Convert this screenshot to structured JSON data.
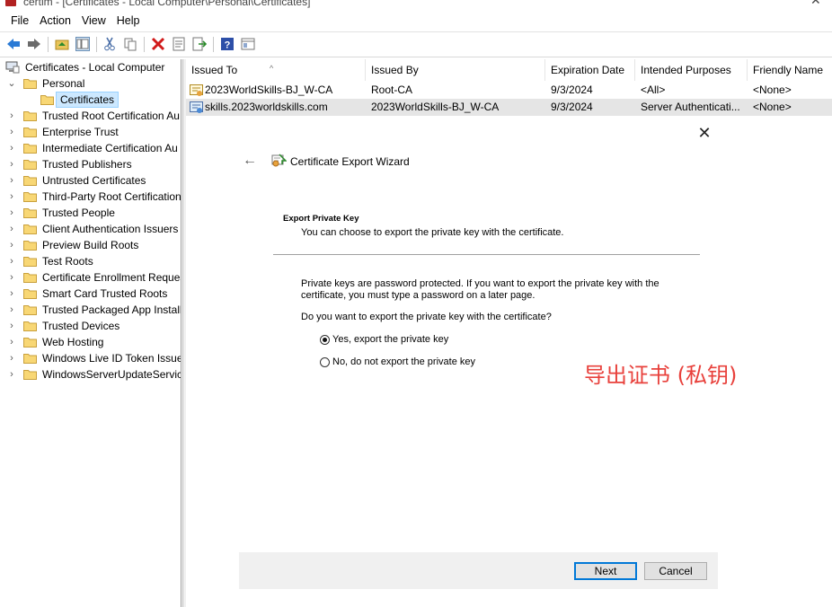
{
  "window": {
    "title": "certlm - [Certificates - Local Computer\\Personal\\Certificates]"
  },
  "menu": [
    "File",
    "Action",
    "View",
    "Help"
  ],
  "toolbar": {
    "icons": [
      "back-icon",
      "forward-icon",
      "up-folder-icon",
      "show-hide-tree-icon",
      "cut-icon",
      "copy-icon",
      "delete-icon",
      "properties-icon",
      "export-list-icon",
      "help-icon",
      "view-icon"
    ]
  },
  "tree": {
    "root": "Certificates - Local Computer",
    "personal": "Personal",
    "selected": "Certificates",
    "stores": [
      "Trusted Root Certification Au",
      "Enterprise Trust",
      "Intermediate Certification Au",
      "Trusted Publishers",
      "Untrusted Certificates",
      "Third-Party Root Certification",
      "Trusted People",
      "Client Authentication Issuers",
      "Preview Build Roots",
      "Test Roots",
      "Certificate Enrollment Reques",
      "Smart Card Trusted Roots",
      "Trusted Packaged App Installa",
      "Trusted Devices",
      "Web Hosting",
      "Windows Live ID Token Issuer",
      "WindowsServerUpdateService"
    ]
  },
  "list": {
    "columns": [
      "Issued To",
      "Issued By",
      "Expiration Date",
      "Intended Purposes",
      "Friendly Name"
    ],
    "rows": [
      [
        "2023WorldSkills-BJ_W-CA",
        "Root-CA",
        "9/3/2024",
        "<All>",
        "<None>"
      ],
      [
        "skills.2023worldskills.com",
        "2023WorldSkills-BJ_W-CA",
        "9/3/2024",
        "Server Authenticati...",
        "<None>"
      ]
    ]
  },
  "wizard": {
    "close": "✕",
    "back": "←",
    "title": "Certificate Export Wizard",
    "section_title": "Export Private Key",
    "section_sub": "You can choose to export the private key with the certificate.",
    "paragraph": "Private keys are password protected. If you want to export the private key with the certificate, you must type a password on a later page.",
    "question": "Do you want to export the private key with the certificate?",
    "option_yes": "Yes, export the private key",
    "option_no": "No, do not export the private key",
    "selected_option": "yes",
    "next": "Next",
    "cancel": "Cancel"
  },
  "annotation": {
    "text": "导出证书 (私钥)",
    "color": "#e8413c"
  },
  "colors": {
    "selection": "#cce8ff",
    "accent": "#0078d7"
  }
}
